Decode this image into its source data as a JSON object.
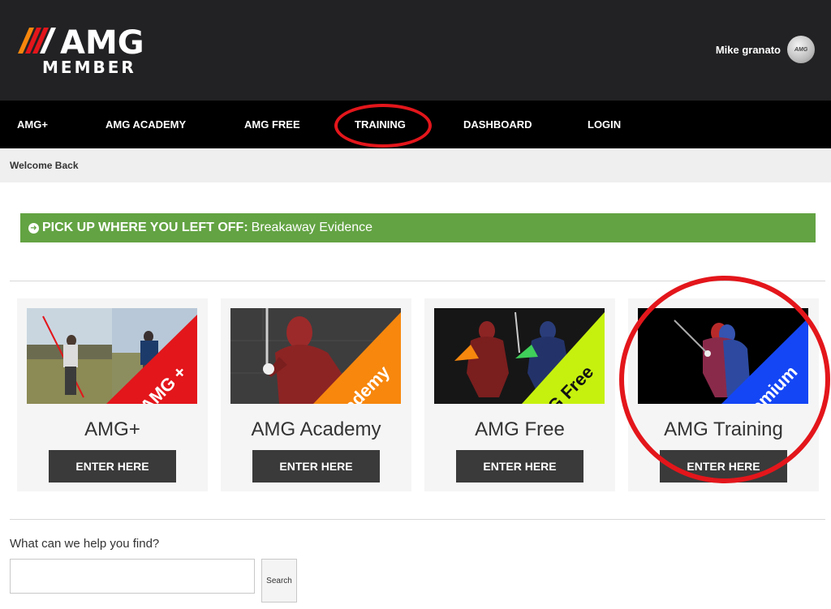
{
  "header": {
    "logo_text": "AMG",
    "logo_subtext": "MEMBER",
    "user_name": "Mike granato",
    "avatar_text": "AMG"
  },
  "nav": {
    "items": [
      {
        "label": "AMG+"
      },
      {
        "label": "AMG ACADEMY"
      },
      {
        "label": "AMG FREE"
      },
      {
        "label": "TRAINING"
      },
      {
        "label": "DASHBOARD"
      },
      {
        "label": "LOGIN"
      }
    ],
    "highlight_color": "#e3161b"
  },
  "breadcrumb": {
    "text": "Welcome Back"
  },
  "resume": {
    "label": "PICK UP WHERE YOU LEFT OFF:",
    "value": "Breakaway Evidence",
    "color": "#63a343"
  },
  "cards": [
    {
      "title": "AMG+",
      "ribbon": "AMG +",
      "ribbon_color": "#e3161b",
      "button": "ENTER HERE"
    },
    {
      "title": "AMG Academy",
      "ribbon": "Academy",
      "ribbon_color": "#f7870d",
      "button": "ENTER HERE"
    },
    {
      "title": "AMG Free",
      "ribbon": "AMG Free",
      "ribbon_color": "#c6f10e",
      "button": "ENTER HERE"
    },
    {
      "title": "AMG Training",
      "ribbon": "Premium",
      "ribbon_color": "#1446f5",
      "button": "ENTER HERE"
    }
  ],
  "search": {
    "prompt": "What can we help you find?",
    "value": "",
    "placeholder": "",
    "button": "Search"
  }
}
